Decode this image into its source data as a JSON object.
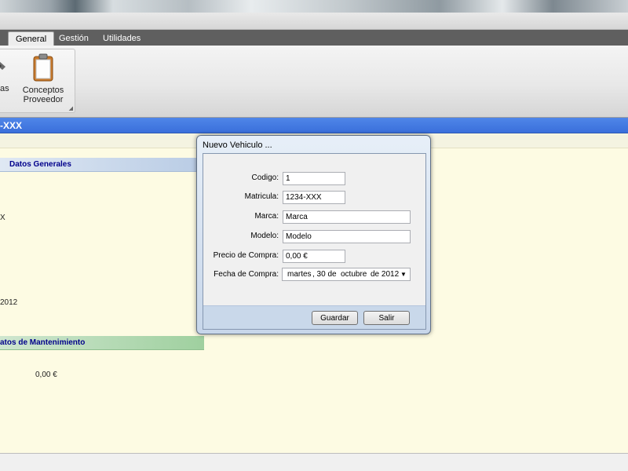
{
  "ribbon": {
    "tabs": [
      {
        "label": "General",
        "active": true
      },
      {
        "label": "Gestión",
        "active": false
      },
      {
        "label": "Utilidades",
        "active": false
      }
    ],
    "buttons": {
      "tools_label": "ientas",
      "conceptos_line1": "Conceptos",
      "conceptos_line2": "Proveedor"
    }
  },
  "record_bar": {
    "text": "-XXX"
  },
  "panel": {
    "section_generales": "Datos Generales",
    "matricula_fragment": "X",
    "fecha_fragment": "2012",
    "section_mantenimiento": "atos de Mantenimiento",
    "importe": "0,00 €"
  },
  "dialog": {
    "title": "Nuevo Vehiculo ...",
    "labels": {
      "codigo": "Codigo:",
      "matricula": "Matricula:",
      "marca": "Marca:",
      "modelo": "Modelo:",
      "precio": "Precio de Compra:",
      "fecha": "Fecha de Compra:"
    },
    "values": {
      "codigo": "1",
      "matricula": "1234-XXX",
      "marca": "Marca",
      "modelo": "Modelo",
      "precio": "0,00 €"
    },
    "date": {
      "weekday": "martes",
      "day": ", 30 de",
      "month": "octubre",
      "year": "de 2012"
    },
    "buttons": {
      "guardar": "Guardar",
      "salir": "Salir"
    }
  },
  "colors": {
    "accent_blue": "#3a6fdb",
    "panel_bg": "#fdfbe3",
    "section_green": "#9fd09f",
    "section_blue": "#b9cce5"
  }
}
